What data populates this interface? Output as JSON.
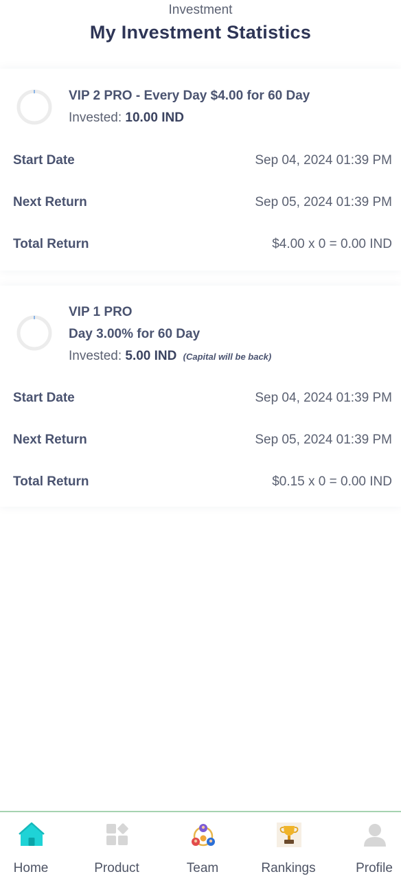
{
  "header": {
    "subtitle": "Investment",
    "title": "My Investment Statistics"
  },
  "investments": [
    {
      "plan_name": "VIP 2 PRO - Every Day $4.00 for 60 Day",
      "invested_label": "Invested:",
      "invested_amount": "10.00 IND",
      "progress_fraction": 0.0,
      "rows": [
        {
          "label": "Start Date",
          "value": "Sep 04, 2024 01:39 PM"
        },
        {
          "label": "Next Return",
          "value": "Sep 05, 2024 01:39 PM"
        },
        {
          "label": "Total Return",
          "value": "$4.00 x 0 = 0.00 IND"
        }
      ]
    },
    {
      "plan_name": "VIP 1 PRO",
      "plan_line2": "Day 3.00% for 60 Day",
      "invested_label": "Invested:",
      "invested_amount": "5.00 IND",
      "invested_note": "(Capital will be back)",
      "progress_fraction": 0.0,
      "rows": [
        {
          "label": "Start Date",
          "value": "Sep 04, 2024 01:39 PM"
        },
        {
          "label": "Next Return",
          "value": "Sep 05, 2024 01:39 PM"
        },
        {
          "label": "Total Return",
          "value": "$0.15 x 0 = 0.00 IND"
        }
      ]
    }
  ],
  "nav": {
    "items": [
      {
        "label": "Home",
        "icon": "home-icon",
        "active": true
      },
      {
        "label": "Product",
        "icon": "product-icon"
      },
      {
        "label": "Team",
        "icon": "team-icon"
      },
      {
        "label": "Rankings",
        "icon": "trophy-icon"
      },
      {
        "label": "Profile",
        "icon": "profile-icon"
      }
    ]
  },
  "colors": {
    "title": "#2e3556",
    "text": "#4a5370",
    "home_accent": "#1fd3d6",
    "ring_track": "#ececec",
    "ring_progress": "#4a90e2",
    "nav_border": "#a5d3b0"
  }
}
